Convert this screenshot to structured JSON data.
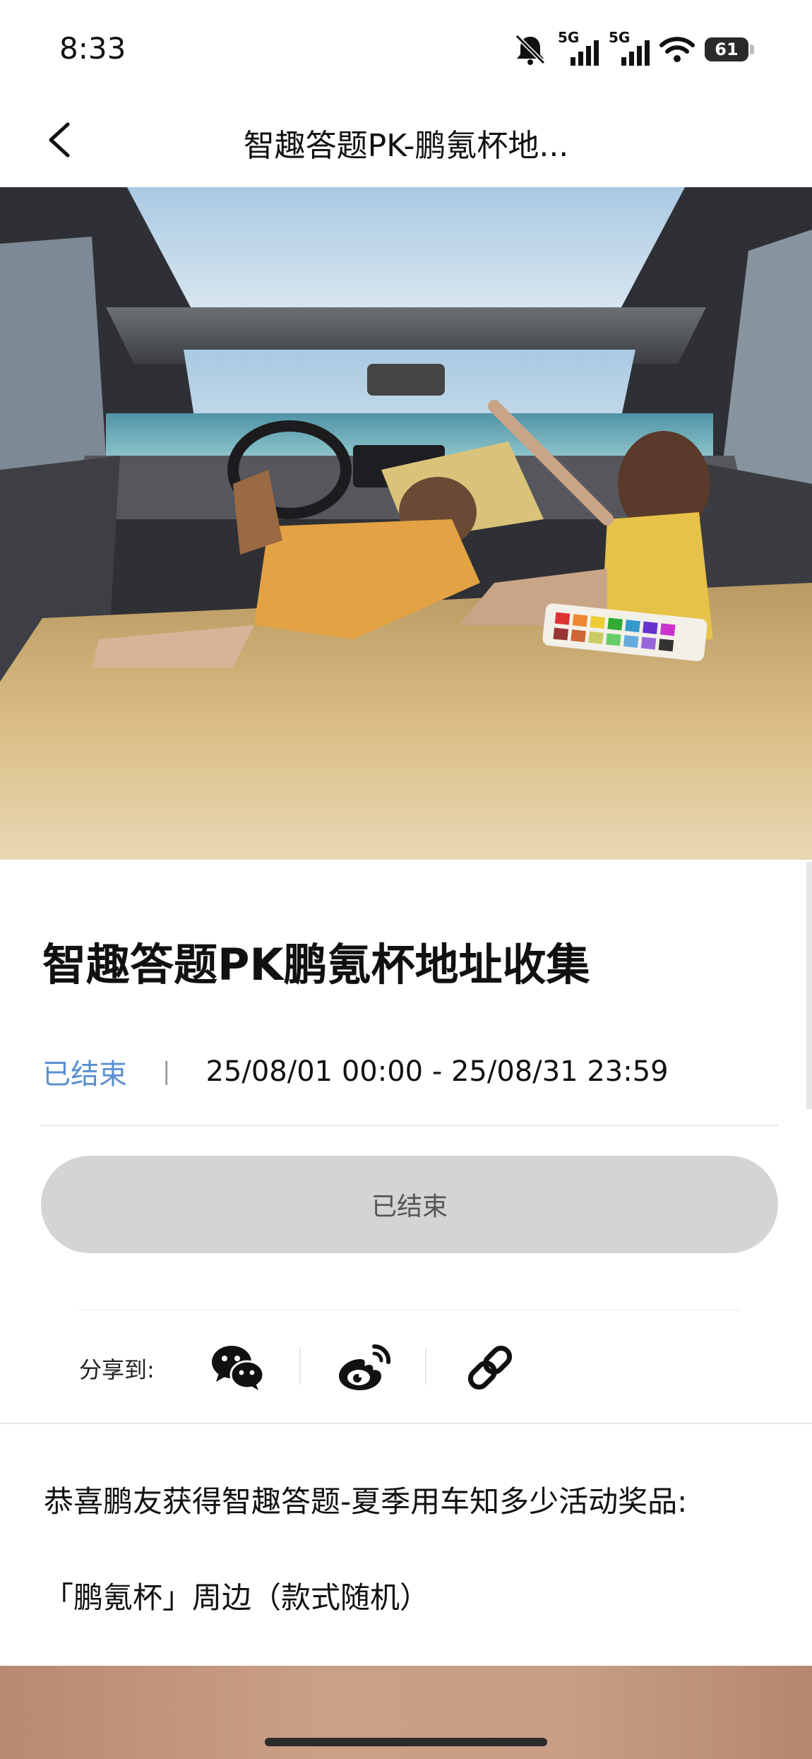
{
  "status_bar": {
    "time": "8:33",
    "signal1_label": "5G",
    "signal2_label": "5G",
    "battery": "61"
  },
  "nav": {
    "title": "智趣答题PK-鹏氪杯地..."
  },
  "event": {
    "title": "智趣答题PK鹏氪杯地址收集",
    "status": "已结束",
    "separator": "|",
    "date_range": "25/08/01 00:00 - 25/08/31 23:59",
    "button_label": "已结束"
  },
  "share": {
    "label": "分享到:",
    "targets": [
      "wechat-icon",
      "weibo-icon",
      "link-icon"
    ]
  },
  "body": {
    "paragraph1": "恭喜鹏友获得智趣答题-夏季用车知多少活动奖品:",
    "paragraph2": "「鹏氪杯」周边（款式随机）"
  },
  "colors": {
    "status_accent": "#5b8fd1",
    "button_bg": "#d4d4d4"
  }
}
